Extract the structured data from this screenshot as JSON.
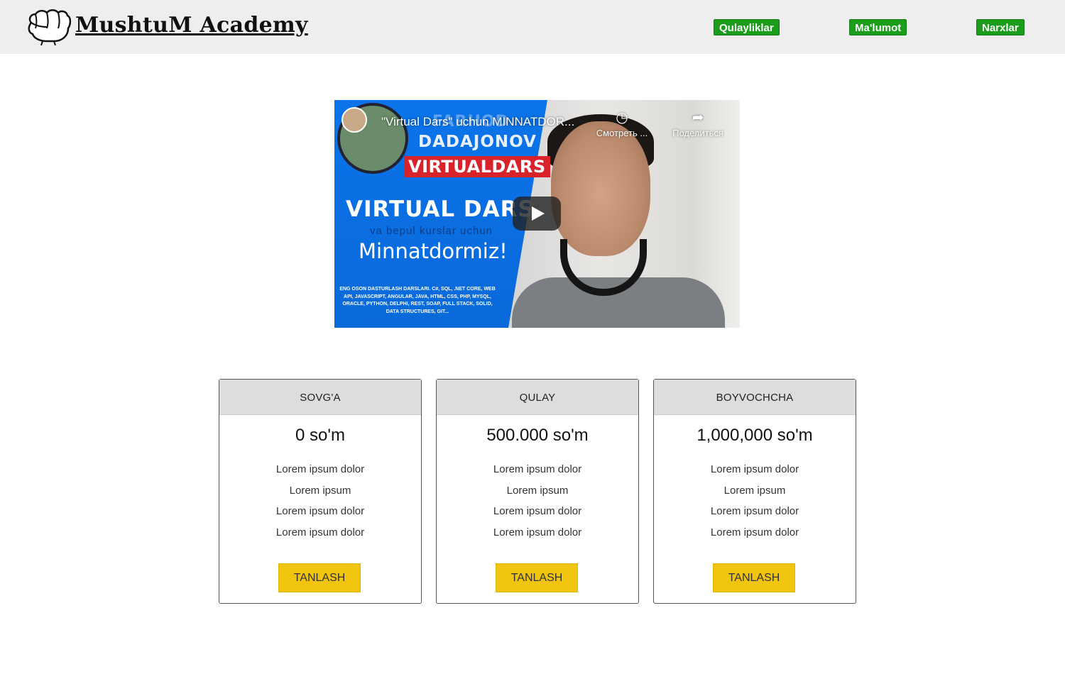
{
  "header": {
    "logo_text": "MushtuM Academy",
    "nav": [
      {
        "label": "Qulayliklar"
      },
      {
        "label": "Ma'lumot"
      },
      {
        "label": "Narxlar"
      }
    ],
    "nav_color": "#1b9c1b"
  },
  "video": {
    "title": "\"Virtual Dars\" uchun MINNATDOR...",
    "watch_label": "Смотреть ...",
    "share_label": "Поделиться",
    "thumbnail": {
      "name_first": "FARHOD",
      "name_last": "DADAJONOV",
      "channel_tag": "VIRTUALDARS",
      "headline": "VIRTUAL DARS",
      "subline": "va bepul kurslar uchun",
      "thanks": "Minnatdormiz!",
      "tech_list": "ENG OSON DASTURLASH DARSLARI. C#, SQL, .NET CORE, WEB API, JAVASCRIPT, ANGULAR, JAVA, HTML, CSS, PHP, MYSQL, ORACLE, PYTHON, DELPHI, REST, SOAP, FULL STACK, SOLID, DATA STRUCTURES, GIT..."
    },
    "accent_blue": "#0b74ea"
  },
  "plans": [
    {
      "name": "SOVG'A",
      "price": "0 so'm",
      "features": [
        "Lorem ipsum dolor",
        "Lorem ipsum",
        "Lorem ipsum dolor",
        "Lorem ipsum dolor"
      ],
      "button": "TANLASH"
    },
    {
      "name": "QULAY",
      "price": "500.000 so'm",
      "features": [
        "Lorem ipsum dolor",
        "Lorem ipsum",
        "Lorem ipsum dolor",
        "Lorem ipsum dolor"
      ],
      "button": "TANLASH"
    },
    {
      "name": "BOYVOCHCHA",
      "price": "1,000,000 so'm",
      "features": [
        "Lorem ipsum dolor",
        "Lorem ipsum",
        "Lorem ipsum dolor",
        "Lorem ipsum dolor"
      ],
      "button": "TANLASH"
    }
  ],
  "button_color": "#f1c40f",
  "icons": {
    "logo": "fist-icon",
    "watch": "clock-icon",
    "share": "share-arrow-icon",
    "play": "play-icon"
  }
}
